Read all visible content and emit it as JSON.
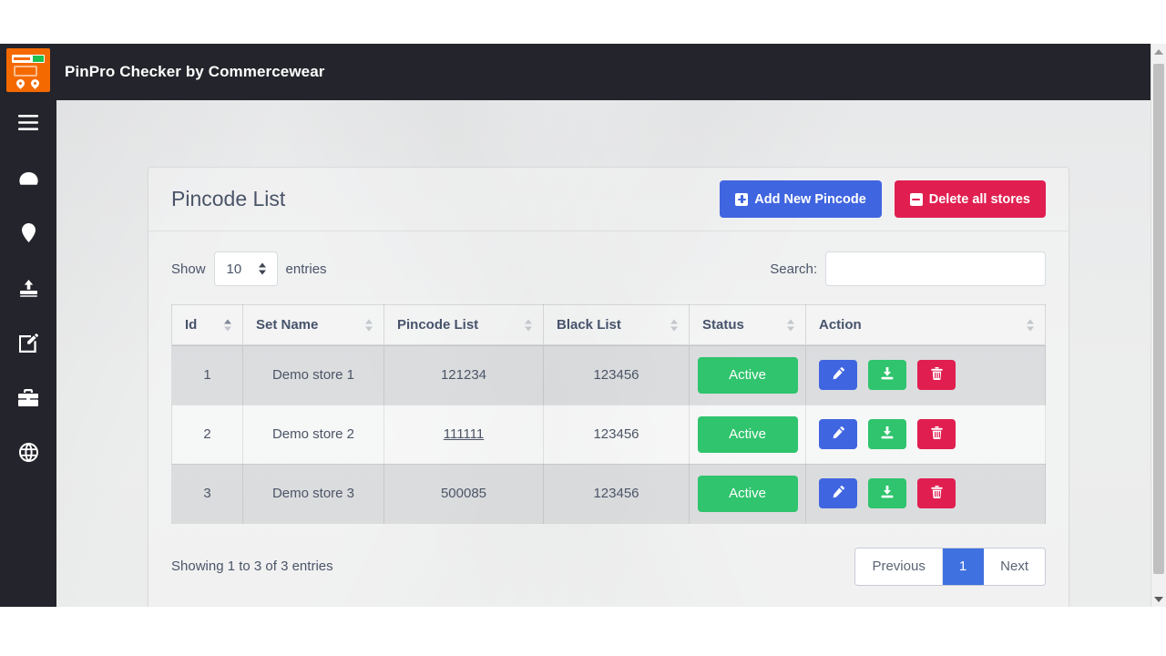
{
  "app": {
    "title": "PinPro Checker by Commercewear",
    "logo_icon": "store-truck-logo-icon"
  },
  "sidebar": {
    "items": [
      {
        "icon": "hamburger-menu-icon",
        "name": "menu-toggle"
      },
      {
        "icon": "dashboard-speedometer-icon",
        "name": "dashboard"
      },
      {
        "icon": "map-pin-icon",
        "name": "pincodes"
      },
      {
        "icon": "upload-icon",
        "name": "upload"
      },
      {
        "icon": "edit-square-icon",
        "name": "edit"
      },
      {
        "icon": "briefcase-icon",
        "name": "stores"
      },
      {
        "icon": "globe-icon",
        "name": "global"
      }
    ]
  },
  "panel": {
    "title": "Pincode List",
    "add_button": "Add New Pincode",
    "delete_button": "Delete all stores"
  },
  "datatable": {
    "show_label": "Show",
    "entries_label": "entries",
    "page_length": "10",
    "search_label": "Search:",
    "search_value": "",
    "search_placeholder": "",
    "columns": [
      {
        "label": "Id",
        "sorted": true
      },
      {
        "label": "Set Name",
        "sorted": false
      },
      {
        "label": "Pincode List",
        "sorted": false
      },
      {
        "label": "Black List",
        "sorted": false
      },
      {
        "label": "Status",
        "sorted": false
      },
      {
        "label": "Action",
        "sorted": false
      }
    ],
    "rows": [
      {
        "id": "1",
        "set_name": "Demo store 1",
        "pincode_list": "121234",
        "black_list": "123456",
        "status": "Active",
        "pincode_underlined": false
      },
      {
        "id": "2",
        "set_name": "Demo store 2",
        "pincode_list": "111111",
        "black_list": "123456",
        "status": "Active",
        "pincode_underlined": true
      },
      {
        "id": "3",
        "set_name": "Demo store 3",
        "pincode_list": "500085",
        "black_list": "123456",
        "status": "Active",
        "pincode_underlined": false
      }
    ],
    "row_actions": [
      {
        "icon": "pencil-edit-icon",
        "name": "edit-row-button",
        "color": "#4065e0"
      },
      {
        "icon": "download-icon",
        "name": "download-row-button",
        "color": "#2fc46d"
      },
      {
        "icon": "trash-delete-icon",
        "name": "delete-row-button",
        "color": "#e01f50"
      }
    ],
    "info": "Showing 1 to 3 of 3 entries",
    "pagination": [
      {
        "label": "Previous",
        "active": false
      },
      {
        "label": "1",
        "active": true
      },
      {
        "label": "Next",
        "active": false
      }
    ]
  },
  "colors": {
    "sidebar_bg": "#24242c",
    "navbar_bg": "#24242c",
    "logo_bg": "#f56a00",
    "primary": "#4065e0",
    "danger": "#e01f50",
    "success": "#2fc46d",
    "content_bg": "#eceded",
    "title_text": "#4a5468"
  }
}
